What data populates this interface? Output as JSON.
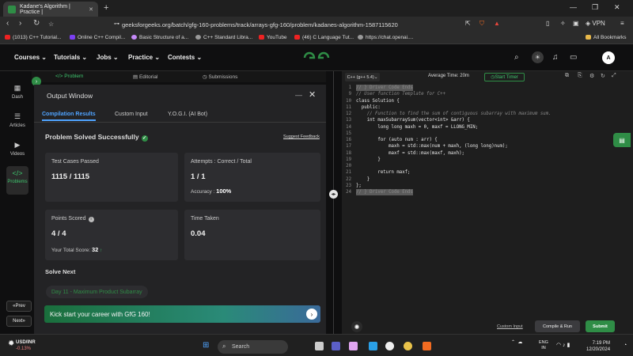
{
  "browser": {
    "tab_title": "Kadane's Algorithm | Practice |",
    "url": "geeksforgeeks.org/batch/gfg-160-problems/track/arrays-gfg-160/problem/kadanes-algorithm-1587115620",
    "vpn_label": "VPN",
    "bookmarks": [
      "(1013) C++ Tutorial...",
      "Online C++ Compil...",
      "Basic Structure of a...",
      "C++ Standard Libra...",
      "YouTube",
      "(46) C Language Tut...",
      "https://chat.openai...."
    ],
    "all_bookmarks": "All Bookmarks"
  },
  "site_nav": {
    "menus": [
      "Courses",
      "Tutorials",
      "Jobs",
      "Practice",
      "Contests"
    ],
    "avatar_letter": "A"
  },
  "left_rail": {
    "items": [
      "Dash",
      "Articles",
      "Videos",
      "Problems"
    ],
    "prev": "Prev",
    "next": "Next"
  },
  "problem_tabs": [
    "Problem",
    "Editorial",
    "Submissions"
  ],
  "output_window": {
    "title": "Output Window",
    "tabs": [
      "Compilation Results",
      "Custom Input",
      "Y.O.G.I. (AI Bot)"
    ],
    "status": "Problem Solved Successfully",
    "suggest_feedback": "Suggest Feedback",
    "cards": {
      "test_cases_label": "Test Cases Passed",
      "test_cases_value": "1115 / 1115",
      "attempts_label": "Attempts : Correct / Total",
      "attempts_value": "1 / 1",
      "accuracy_label": "Accuracy :",
      "accuracy_value": "100%",
      "points_label": "Points Scored",
      "points_value": "4 / 4",
      "total_score_label": "Your Total Score:",
      "total_score_value": "32",
      "time_label": "Time Taken",
      "time_value": "0.04"
    },
    "solve_next": "Solve Next",
    "next_problem": "Day 11 - Maximum Product Subarray",
    "banner": "Kick start your career with GfG 160!"
  },
  "editor": {
    "language": "C++ (g++ 5.4)",
    "avg_time": "Average Time: 20m",
    "start_timer": "Start Timer",
    "lines": [
      {
        "n": "1",
        "t": "// } Driver Code Ends",
        "c": "hl"
      },
      {
        "n": "9",
        "t": "// User function Template for C++",
        "c": "cm"
      },
      {
        "n": "10",
        "t": "class Solution {",
        "c": ""
      },
      {
        "n": "11",
        "t": "  public:",
        "c": ""
      },
      {
        "n": "12",
        "t": "    // Function to find the sum of contiguous subarray with maximum sum.",
        "c": "cm"
      },
      {
        "n": "13",
        "t": "    int maxSubarraySum(vector<int> &arr) {",
        "c": ""
      },
      {
        "n": "14",
        "t": "        long long maxh = 0, maxf = LLONG_MIN;",
        "c": ""
      },
      {
        "n": "15",
        "t": "",
        "c": ""
      },
      {
        "n": "16",
        "t": "        for (auto num : arr) {",
        "c": ""
      },
      {
        "n": "17",
        "t": "            maxh = std::max(num + maxh, (long long)num);",
        "c": ""
      },
      {
        "n": "18",
        "t": "            maxf = std::max(maxf, maxh);",
        "c": ""
      },
      {
        "n": "19",
        "t": "        }",
        "c": ""
      },
      {
        "n": "20",
        "t": "",
        "c": ""
      },
      {
        "n": "21",
        "t": "        return maxf;",
        "c": ""
      },
      {
        "n": "22",
        "t": "    }",
        "c": ""
      },
      {
        "n": "23",
        "t": "};",
        "c": ""
      },
      {
        "n": "24",
        "t": "// } Driver Code Ends",
        "c": "hl"
      }
    ],
    "custom_input": "Custom Input",
    "compile_run": "Compile & Run",
    "submit": "Submit"
  },
  "taskbar": {
    "ticker": "USD/INR",
    "change": "-0.13%",
    "search_placeholder": "Search",
    "lang_top": "ENG",
    "lang_bottom": "IN",
    "time": "7:19 PM",
    "date": "12/20/2024"
  },
  "colors": {
    "brand_green": "#2f8d46",
    "accent_blue": "#4fa3ff"
  }
}
